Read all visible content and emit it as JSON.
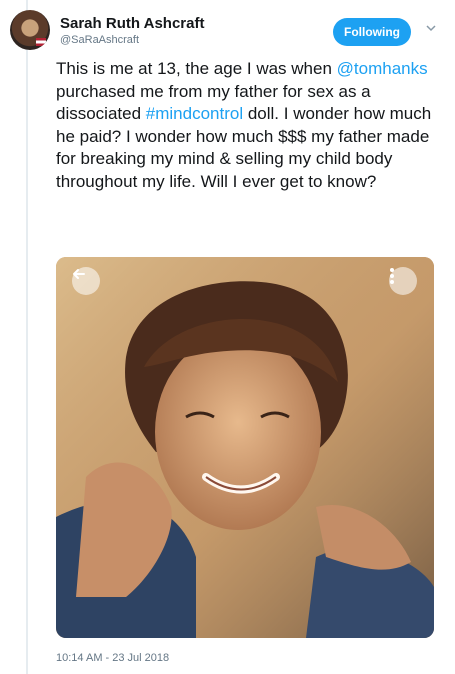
{
  "author": {
    "display_name": "Sarah Ruth Ashcraft",
    "handle": "@SaRaAshcraft"
  },
  "header": {
    "follow_label": "Following",
    "menu_icon": "chevron-down-icon"
  },
  "tweet": {
    "text_1": "This is me at 13, the age I was when ",
    "mention": "@tomhanks",
    "text_2": " purchased me from my father for sex as a dissociated ",
    "hashtag": "#mindcontrol",
    "text_3": " doll. I wonder how much he paid? I wonder how much $$$ my father made for breaking my mind & selling my child body throughout my life. Will I ever get to know?",
    "timestamp": "10:14 AM - 23 Jul 2018"
  },
  "media": {
    "back_icon": "back-arrow-icon",
    "more_icon": "more-options-icon"
  },
  "colors": {
    "accent": "#1da1f2",
    "muted": "#657786",
    "text": "#14171a"
  }
}
